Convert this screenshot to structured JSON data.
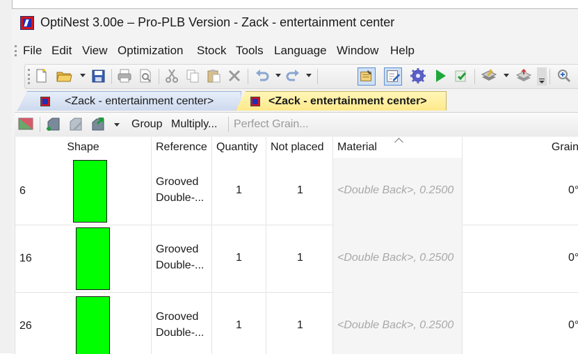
{
  "window": {
    "title": "OptiNest 3.00e – Pro-PLB Version - Zack - entertainment center"
  },
  "menu": [
    "File",
    "Edit",
    "View",
    "Optimization",
    "Stock",
    "Tools",
    "Language",
    "Window",
    "Help"
  ],
  "toolbar": {
    "icons": [
      "new-document-icon",
      "open-folder-icon",
      "save-icon",
      "print-icon",
      "print-preview-icon",
      "cut-icon",
      "copy-icon",
      "paste-icon",
      "delete-icon",
      "undo-icon",
      "redo-icon",
      "stock-properties-icon",
      "edit-parts-icon",
      "settings-gear-icon",
      "run-optimization-icon",
      "check-icon",
      "layer-tool-icon",
      "stack-tool-icon",
      "zoom-in-icon"
    ]
  },
  "tabs": [
    {
      "label": "<Zack - entertainment center>",
      "active": false
    },
    {
      "label": "<Zack - entertainment center>",
      "active": true
    }
  ],
  "subtoolbar": {
    "group_label": "Group",
    "multiply_label": "Multiply...",
    "grain_label": "Perfect Grain..."
  },
  "grid": {
    "headers": {
      "shape": "Shape",
      "reference": "Reference",
      "quantity": "Quantity",
      "not_placed": "Not placed",
      "material": "Material",
      "grain": "Grain"
    },
    "rows": [
      {
        "id": "6",
        "ref1": "Grooved",
        "ref2": "Double-...",
        "quantity": "1",
        "not_placed": "1",
        "material": "<Double Back>, 0.2500",
        "grain": "0°"
      },
      {
        "id": "16",
        "ref1": "Grooved",
        "ref2": "Double-...",
        "quantity": "1",
        "not_placed": "1",
        "material": "<Double Back>, 0.2500",
        "grain": "0°"
      },
      {
        "id": "26",
        "ref1": "Grooved",
        "ref2": "Double-...",
        "quantity": "1",
        "not_placed": "1",
        "material": "<Double Back>, 0.2500",
        "grain": "0°"
      }
    ],
    "shape_color": "#00ff00"
  }
}
